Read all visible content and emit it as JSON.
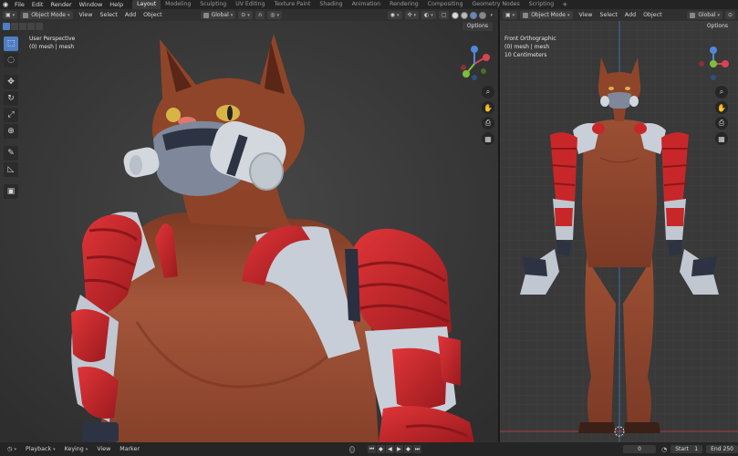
{
  "menu": {
    "items": [
      "File",
      "Edit",
      "Render",
      "Window",
      "Help"
    ]
  },
  "workspaces": {
    "tabs": [
      "Layout",
      "Modeling",
      "Sculpting",
      "UV Editing",
      "Texture Paint",
      "Shading",
      "Animation",
      "Rendering",
      "Compositing",
      "Geometry Nodes",
      "Scripting"
    ],
    "active": "Layout",
    "add_label": "+"
  },
  "left_view": {
    "mode": "Object Mode",
    "menus": [
      "View",
      "Select",
      "Add",
      "Object"
    ],
    "transform": "Global",
    "options": "Options",
    "info_line1": "User Perspective",
    "info_line2": "(0) mesh | mesh"
  },
  "right_view": {
    "mode": "Object Mode",
    "menus": [
      "View",
      "Select",
      "Add",
      "Object"
    ],
    "transform": "Global",
    "options": "Options",
    "info_line1": "Front Orthographic",
    "info_line2": "(0) mesh | mesh",
    "info_line3": "10 Centimeters"
  },
  "timeline": {
    "playback": "Playback",
    "keying": "Keying",
    "view": "View",
    "marker": "Marker",
    "current_frame": "0",
    "start_label": "Start",
    "start_value": "1",
    "end_label": "End",
    "end_value": "250"
  },
  "colors": {
    "accent": "#4f7ec4",
    "fur": "#9b4a2a",
    "armor_white": "#c9ced6",
    "armor_red": "#c8272a",
    "viewport_bg": "#3a3a3a"
  }
}
